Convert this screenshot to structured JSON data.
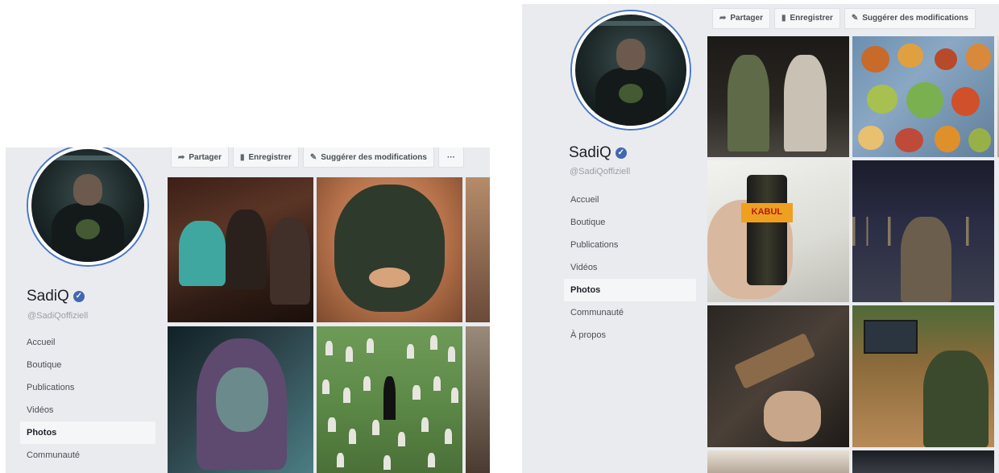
{
  "screens": [
    {
      "toolbar": {
        "share_label": "Partager",
        "save_label": "Enregistrer",
        "suggest_label": "Suggérer des modifications",
        "more_label": "···"
      },
      "profile": {
        "name": "SadiQ",
        "handle": "@SadiQoffiziell",
        "verified": true
      },
      "nav": [
        "Accueil",
        "Boutique",
        "Publications",
        "Vidéos",
        "Photos",
        "Communauté"
      ],
      "active_nav": "Photos"
    },
    {
      "toolbar": {
        "share_label": "Partager",
        "save_label": "Enregistrer",
        "suggest_label": "Suggérer des modifications"
      },
      "profile": {
        "name": "SadiQ",
        "handle": "@SadiQoffiziell",
        "verified": true
      },
      "nav": [
        "Accueil",
        "Boutique",
        "Publications",
        "Vidéos",
        "Photos",
        "Communauté",
        "À propos"
      ],
      "active_nav": "Photos",
      "can_label": "KABUL"
    }
  ],
  "icons": {
    "share": "share-arrow-icon",
    "save": "bookmark-icon",
    "suggest": "pencil-icon",
    "verified": "verified-badge-icon"
  },
  "colors": {
    "sidebar_bg": "#e9ebee",
    "avatar_ring": "#4a76c9",
    "verified_badge": "#4267b2",
    "active_nav_bg": "#f5f6f7"
  }
}
